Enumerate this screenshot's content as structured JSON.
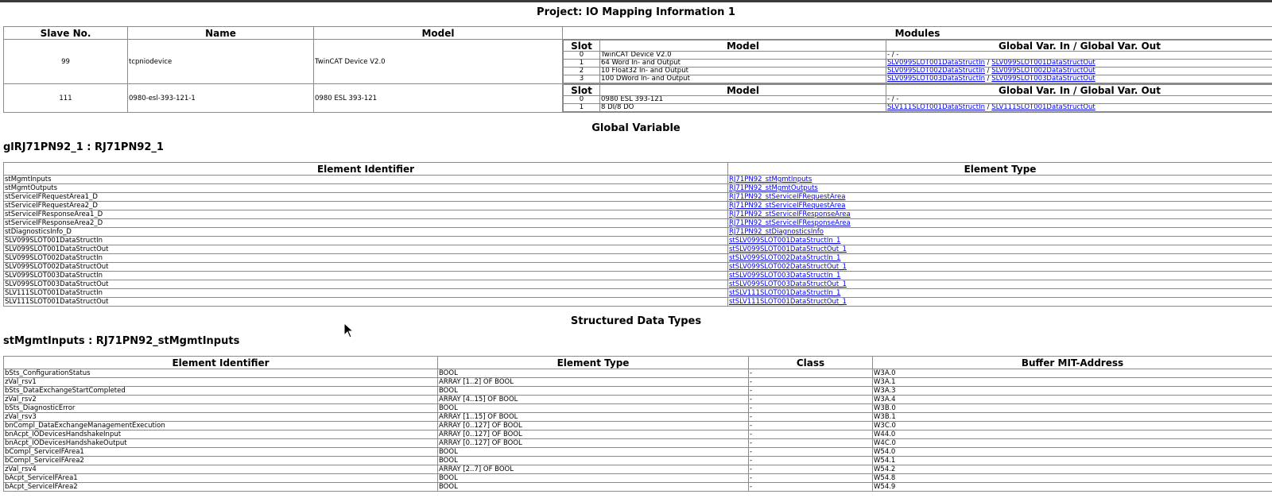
{
  "project_title": "Project: IO Mapping Information 1",
  "slave_table": {
    "headers": [
      "Slave No.",
      "Name",
      "Model",
      "Modules"
    ],
    "module_headers": [
      "Slot",
      "Model",
      "Global Var. In / Global Var. Out"
    ],
    "slaves": [
      {
        "no": "99",
        "name": "tcpniodevice",
        "model": "TwinCAT Device V2.0",
        "modules": [
          {
            "slot": "0",
            "model": "TwinCAT Device V2.0",
            "in": "",
            "sep": "- / -",
            "out": ""
          },
          {
            "slot": "1",
            "model": "64 Word In- and Output",
            "in": "SLV099SLOT001DataStructIn",
            "sep": " / ",
            "out": "SLV099SLOT001DataStructOut"
          },
          {
            "slot": "2",
            "model": "10 Float32 In- and Output",
            "in": "SLV099SLOT002DataStructIn",
            "sep": " / ",
            "out": "SLV099SLOT002DataStructOut"
          },
          {
            "slot": "3",
            "model": "100 DWord In- and Output",
            "in": "SLV099SLOT003DataStructIn",
            "sep": " / ",
            "out": "SLV099SLOT003DataStructOut"
          }
        ]
      },
      {
        "no": "111",
        "name": "0980-esl-393-121-1",
        "model": "0980 ESL 393-121",
        "modules": [
          {
            "slot": "0",
            "model": "0980 ESL 393-121",
            "in": "",
            "sep": "- / -",
            "out": ""
          },
          {
            "slot": "1",
            "model": "8 DI/8 DO",
            "in": "SLV111SLOT001DataStructIn",
            "sep": " / ",
            "out": "SLV111SLOT001DataStructOut"
          }
        ]
      }
    ]
  },
  "global_variable": {
    "heading": "Global Variable",
    "subheading": "glRJ71PN92_1 : RJ71PN92_1",
    "headers": [
      "Element Identifier",
      "Element Type"
    ],
    "rows": [
      [
        "stMgmtInputs",
        "RJ71PN92_stMgmtInputs"
      ],
      [
        "stMgmtOutputs",
        "RJ71PN92_stMgmtOutputs"
      ],
      [
        "stServiceIFRequestArea1_D",
        "RJ71PN92_stServiceIFRequestArea"
      ],
      [
        "stServiceIFRequestArea2_D",
        "RJ71PN92_stServiceIFRequestArea"
      ],
      [
        "stServiceIFResponseArea1_D",
        "RJ71PN92_stServiceIFResponseArea"
      ],
      [
        "stServiceIFResponseArea2_D",
        "RJ71PN92_stServiceIFResponseArea"
      ],
      [
        "stDiagnosticsInfo_D",
        "RJ71PN92_stDiagnosticsInfo"
      ],
      [
        "SLV099SLOT001DataStructIn",
        "stSLV099SLOT001DataStructIn_1"
      ],
      [
        "SLV099SLOT001DataStructOut",
        "stSLV099SLOT001DataStructOut_1"
      ],
      [
        "SLV099SLOT002DataStructIn",
        "stSLV099SLOT002DataStructIn_1"
      ],
      [
        "SLV099SLOT002DataStructOut",
        "stSLV099SLOT002DataStructOut_1"
      ],
      [
        "SLV099SLOT003DataStructIn",
        "stSLV099SLOT003DataStructIn_1"
      ],
      [
        "SLV099SLOT003DataStructOut",
        "stSLV099SLOT003DataStructOut_1"
      ],
      [
        "SLV111SLOT001DataStructIn",
        "stSLV111SLOT001DataStructIn_1"
      ],
      [
        "SLV111SLOT001DataStructOut",
        "stSLV111SLOT001DataStructOut_1"
      ]
    ]
  },
  "structured_types": {
    "heading": "Structured Data Types",
    "subheading": "stMgmtInputs : RJ71PN92_stMgmtInputs",
    "headers": [
      "Element Identifier",
      "Element Type",
      "Class",
      "Buffer MIT-Address"
    ],
    "rows": [
      [
        "bSts_ConfigurationStatus",
        "BOOL",
        "-",
        "W3A.0"
      ],
      [
        "zVal_rsv1",
        "ARRAY [1..2] OF BOOL",
        "-",
        "W3A.1"
      ],
      [
        "bSts_DataExchangeStartCompleted",
        "BOOL",
        "-",
        "W3A.3"
      ],
      [
        "zVal_rsv2",
        "ARRAY [4..15] OF BOOL",
        "-",
        "W3A.4"
      ],
      [
        "bSts_DiagnosticError",
        "BOOL",
        "-",
        "W3B.0"
      ],
      [
        "zVal_rsv3",
        "ARRAY [1..15] OF BOOL",
        "-",
        "W3B.1"
      ],
      [
        "bnCompl_DataExchangeManagementExecution",
        "ARRAY [0..127] OF BOOL",
        "-",
        "W3C.0"
      ],
      [
        "bnAcpt_IODevicesHandshakeInput",
        "ARRAY [0..127] OF BOOL",
        "-",
        "W44.0"
      ],
      [
        "bnAcpt_IODevicesHandshakeOutput",
        "ARRAY [0..127] OF BOOL",
        "-",
        "W4C.0"
      ],
      [
        "bCompl_ServiceIFArea1",
        "BOOL",
        "-",
        "W54.0"
      ],
      [
        "bCompl_ServiceIFArea2",
        "BOOL",
        "-",
        "W54.1"
      ],
      [
        "zVal_rsv4",
        "ARRAY [2..7] OF BOOL",
        "-",
        "W54.2"
      ],
      [
        "bAcpt_ServiceIFArea1",
        "BOOL",
        "-",
        "W54.8"
      ],
      [
        "bAcpt_ServiceIFArea2",
        "BOOL",
        "-",
        "W54.9"
      ]
    ]
  }
}
